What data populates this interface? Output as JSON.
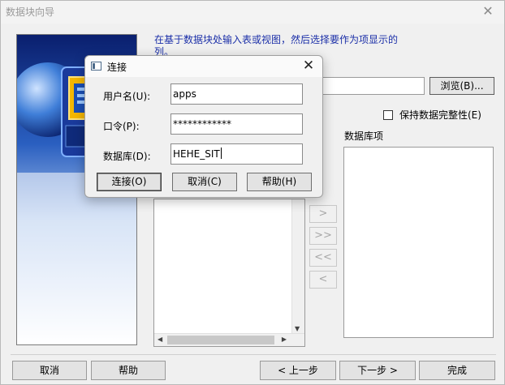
{
  "wizard": {
    "title": "数据块向导",
    "intro_text": "在基于数据块处输入表或视图，然后选择要作为项显示的列。",
    "browse_button": "浏览(B)...",
    "path_value": "",
    "keep_integrity_label": "保持数据完整性(E)",
    "db_items_label": "数据库项",
    "move_buttons": [
      ">",
      ">>",
      "<<",
      "<"
    ],
    "footer": {
      "cancel": "取消",
      "help": "帮助",
      "back": "< 上一步",
      "next": "下一步 >",
      "finish": "完成"
    }
  },
  "connect_dialog": {
    "title": "连接",
    "username_label": "用户名(U):",
    "username_value": "apps",
    "password_label": "口令(P):",
    "password_value": "************",
    "database_label": "数据库(D):",
    "database_value": "HEHE_SIT",
    "connect_button": "连接(O)",
    "cancel_button": "取消(C)",
    "help_button": "帮助(H)"
  },
  "colors": {
    "intro_text": "#1b2fa8",
    "dialog_background": "#f0f0f0"
  }
}
